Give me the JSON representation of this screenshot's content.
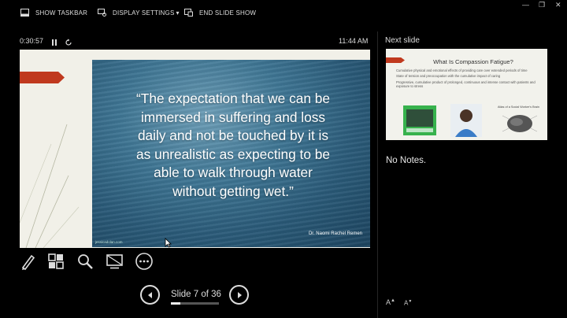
{
  "topbar": {
    "show_taskbar": "SHOW TASKBAR",
    "display_settings": "DISPLAY SETTINGS",
    "end_slide_show": "END SLIDE SHOW"
  },
  "window": {
    "minimize": "—",
    "restore": "❐",
    "close": "✕"
  },
  "presenter": {
    "elapsed": "0:30:57",
    "clock": "11:44 AM",
    "pause_icon": "pause-icon",
    "restart_icon": "restart-icon"
  },
  "slide": {
    "quote_lines": [
      "“The expectation that we can be",
      "immersed in suffering and loss",
      "daily and not be touched by it is",
      "as unrealistic as expecting to be",
      "able to walk through water",
      "without getting wet.”"
    ],
    "author": "Dr. Naomi Rachel Remen",
    "credit": "jessicadolan.com",
    "accent_color": "#c0391e"
  },
  "nav": {
    "slide_label": "Slide 7 of 36",
    "progress_fraction": 0.19
  },
  "next_slide": {
    "label": "Next slide",
    "title": "What Is Compassion Fatigue?",
    "bullets": [
      "Cumulative physical and emotional effects of providing care over extended periods of time",
      "State of tension and preoccupation with the cumulative impact of caring",
      "Progressive, cumulative product of prolonged, continuous and intense contact with patients and exposure to stress"
    ],
    "image_caption": "Atlas of a Social Worker's Brain"
  },
  "notes": {
    "text": "No Notes."
  },
  "font_controls": {
    "increase": "A",
    "decrease": "A"
  }
}
